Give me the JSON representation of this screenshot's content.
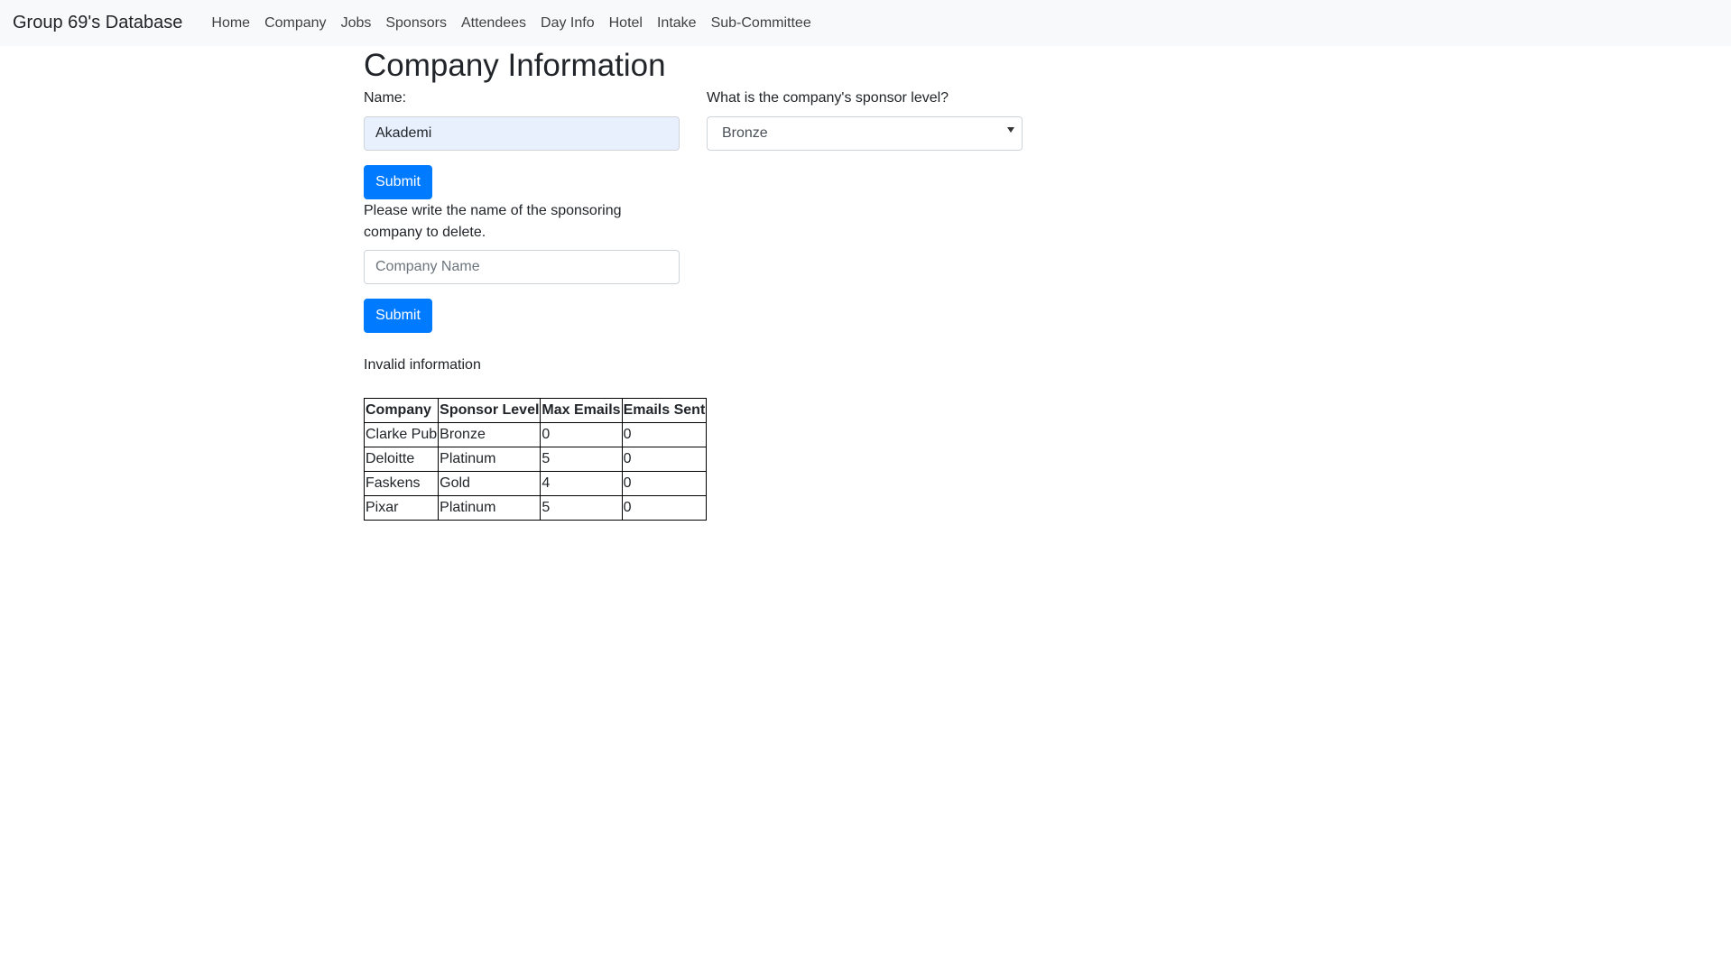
{
  "navbar": {
    "brand": "Group 69's Database",
    "links": [
      "Home",
      "Company",
      "Jobs",
      "Sponsors",
      "Attendees",
      "Day Info",
      "Hotel",
      "Intake",
      "Sub-Committee"
    ]
  },
  "page": {
    "title": "Company Information"
  },
  "add_form": {
    "name_label": "Name:",
    "name_value": "Akademi",
    "sponsor_label": "What is the company's sponsor level?",
    "sponsor_selected": "Bronze",
    "submit_label": "Submit"
  },
  "delete_form": {
    "prompt": "Please write the name of the sponsoring company to delete.",
    "placeholder": "Company Name",
    "submit_label": "Submit"
  },
  "status_message": "Invalid information",
  "table": {
    "headers": [
      "Company",
      "Sponsor Level",
      "Max Emails",
      "Emails Sent"
    ],
    "rows": [
      [
        "Clarke Pub",
        "Bronze",
        "0",
        "0"
      ],
      [
        "Deloitte",
        "Platinum",
        "5",
        "0"
      ],
      [
        "Faskens",
        "Gold",
        "4",
        "0"
      ],
      [
        "Pixar",
        "Platinum",
        "5",
        "0"
      ]
    ]
  }
}
